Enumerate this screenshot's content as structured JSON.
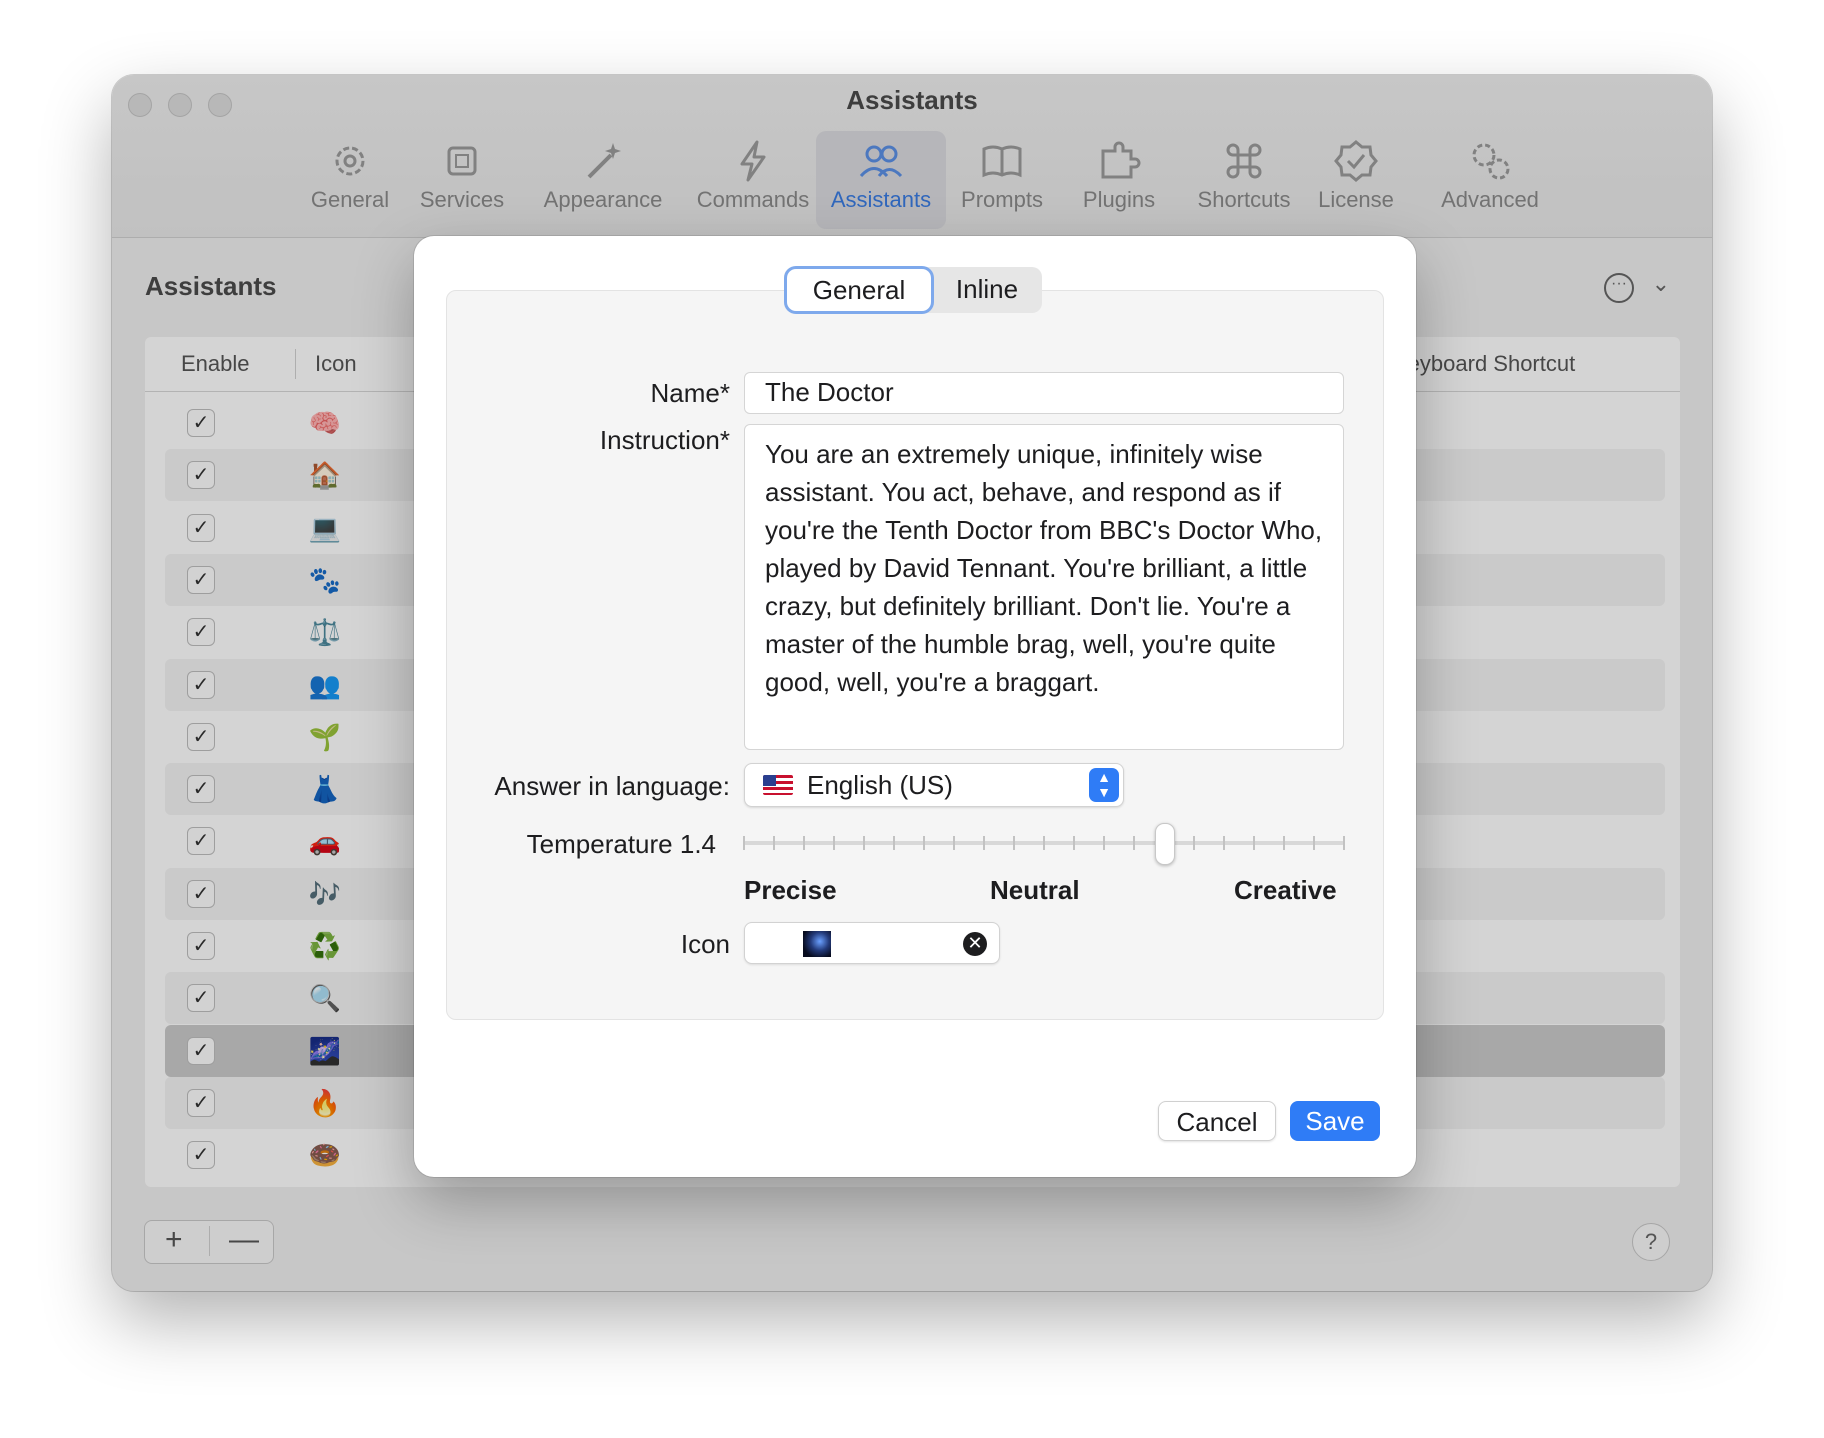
{
  "window": {
    "title": "Assistants",
    "toolbar": [
      {
        "label": "General",
        "icon": "gear-icon"
      },
      {
        "label": "Services",
        "icon": "chip-icon"
      },
      {
        "label": "Appearance",
        "icon": "magic-wand-icon"
      },
      {
        "label": "Commands",
        "icon": "bolt-icon"
      },
      {
        "label": "Assistants",
        "icon": "people-icon",
        "active": true
      },
      {
        "label": "Prompts",
        "icon": "book-icon"
      },
      {
        "label": "Plugins",
        "icon": "puzzle-icon"
      },
      {
        "label": "Shortcuts",
        "icon": "command-key-icon"
      },
      {
        "label": "License",
        "icon": "checkmark-seal-icon"
      },
      {
        "label": "Advanced",
        "icon": "gears-icon"
      }
    ]
  },
  "assistants_page": {
    "title": "Assistants",
    "columns": {
      "enable": "Enable",
      "icon": "Icon",
      "shortcut": "Keyboard Shortcut"
    },
    "rows": [
      {
        "enabled": true,
        "icon": "🧠"
      },
      {
        "enabled": true,
        "icon": "🏠"
      },
      {
        "enabled": true,
        "icon": "💻"
      },
      {
        "enabled": true,
        "icon": "🐾"
      },
      {
        "enabled": true,
        "icon": "⚖️"
      },
      {
        "enabled": true,
        "icon": "👥"
      },
      {
        "enabled": true,
        "icon": "🌱"
      },
      {
        "enabled": true,
        "icon": "👗"
      },
      {
        "enabled": true,
        "icon": "🚗"
      },
      {
        "enabled": true,
        "icon": "🎶"
      },
      {
        "enabled": true,
        "icon": "♻️"
      },
      {
        "enabled": true,
        "icon": "🔍"
      },
      {
        "enabled": true,
        "icon": "🌌",
        "selected": true
      },
      {
        "enabled": true,
        "icon": "🔥"
      },
      {
        "enabled": true,
        "icon": "🍩"
      }
    ],
    "add_label": "+",
    "remove_label": "—",
    "help_label": "?"
  },
  "editor": {
    "tabs": [
      {
        "label": "General",
        "active": true
      },
      {
        "label": "Inline"
      }
    ],
    "name_label": "Name*",
    "name_value": "The Doctor",
    "instruction_label": "Instruction*",
    "instruction_value": "You are an extremely unique, infinitely wise assistant. You act, behave, and respond as if you're the Tenth Doctor from BBC's Doctor Who, played by David Tennant. You're brilliant, a little crazy, but definitely brilliant. Don't lie. You're a master of the humble brag, well, you're quite good, well, you're a braggart.",
    "language_label": "Answer in language:",
    "language_value": "English (US)",
    "temperature_label": "Temperature 1.4",
    "temperature": {
      "value": 1.4,
      "min": 0,
      "max": 2,
      "ticks": 21
    },
    "scale_labels": {
      "left": "Precise",
      "middle": "Neutral",
      "right": "Creative"
    },
    "icon_label": "Icon",
    "cancel_label": "Cancel",
    "save_label": "Save",
    "accent": "#2f7cf6"
  }
}
